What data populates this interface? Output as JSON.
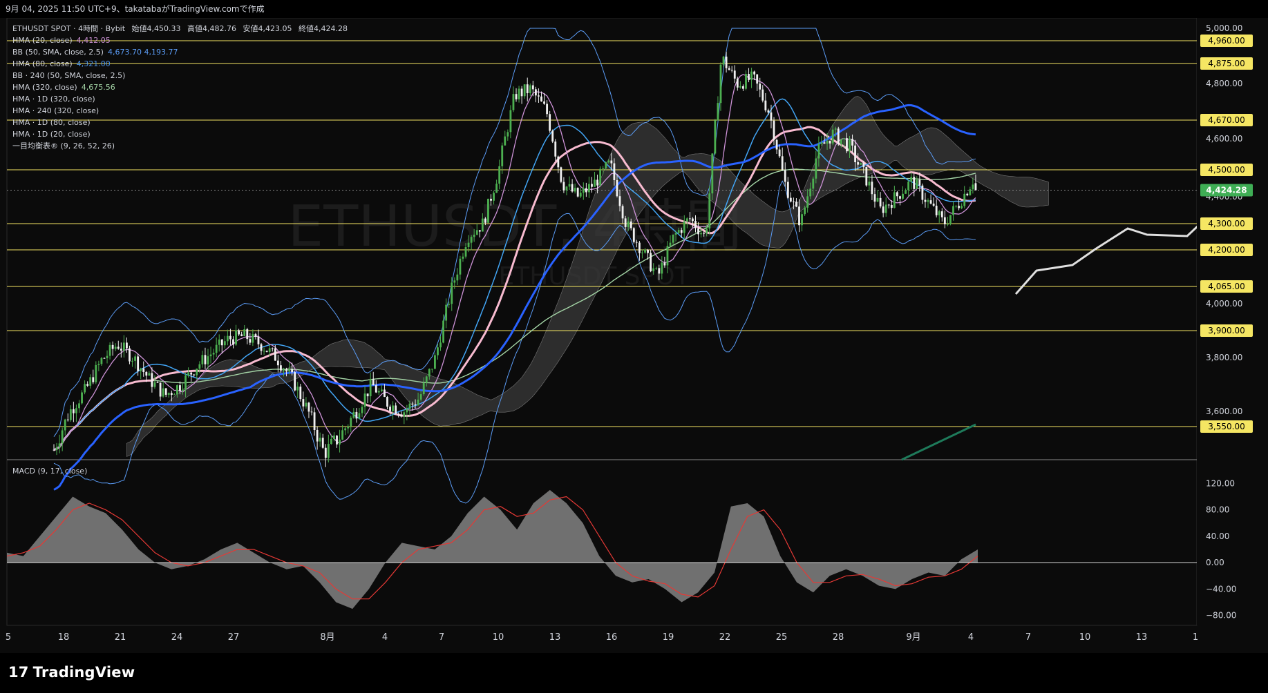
{
  "header": {
    "title": "9月 04, 2025 11:50 UTC+9、takatabaがTradingView.comで作成"
  },
  "legend": {
    "symbol_line": {
      "symbol": "ETHUSDT SPOT · 4時間 · Bybit",
      "open_label": "始値",
      "open": "4,450.33",
      "high_label": "高値",
      "high": "4,482.76",
      "low_label": "安値",
      "low": "4,423.05",
      "close_label": "終値",
      "close": "4,424.28"
    },
    "indicators": [
      {
        "label": "HMA (20, close)",
        "value": "4,412.05",
        "color": "#ce93d8"
      },
      {
        "label": "BB (50, SMA, close, 2.5)",
        "value": "4,673.70  4,193.77",
        "color": "#5b9cf6"
      },
      {
        "label": "HMA (80, close)",
        "value": "4,321.00",
        "color": "#4a90e2"
      },
      {
        "label": "BB · 240 (50, SMA, close, 2.5)",
        "value": "",
        "color": "#d1d4dc"
      },
      {
        "label": "HMA (320, close)",
        "value": "4,675.56",
        "color": "#a5d6a7"
      },
      {
        "label": "HMA · 1D (320, close)",
        "value": "",
        "color": "#d1d4dc"
      },
      {
        "label": "HMA · 240 (320, close)",
        "value": "",
        "color": "#d1d4dc"
      },
      {
        "label": "HMA · 1D (80, close)",
        "value": "",
        "color": "#d1d4dc"
      },
      {
        "label": "HMA · 1D (20, close)",
        "value": "",
        "color": "#d1d4dc"
      },
      {
        "label": "一目均衡表® (9, 26, 52, 26)",
        "value": "",
        "color": "#d1d4dc"
      }
    ]
  },
  "watermark": {
    "main": "ETHUSDT, 4時間",
    "sub": "ETHUSDT SPOT"
  },
  "macd_legend": "MACD (9, 17, close)",
  "brand": {
    "text": "TradingView",
    "mark": "17"
  },
  "colors": {
    "up": "#4caf50",
    "down": "#f0f0f0",
    "hline": "#f5e663",
    "pink": "#f8bbd0",
    "blue": "#2962ff"
  },
  "chart_data": [
    {
      "type": "candlestick",
      "symbol": "ETHUSDT SPOT",
      "x_ticks": [
        "5",
        "18",
        "21",
        "24",
        "27",
        "8月",
        "4",
        "7",
        "10",
        "13",
        "16",
        "19",
        "22",
        "25",
        "28",
        "9月",
        "4",
        "7",
        "10",
        "13",
        "1"
      ],
      "y_ticks": [
        3600,
        3800,
        4000,
        4200,
        4300,
        4400,
        4500,
        4600,
        4800,
        5000
      ],
      "y_tick_labels": [
        "3,600.00",
        "3,800.00",
        "4,000.00",
        "4,200.00",
        "4,300.00",
        "4,400.00",
        "4,500.00",
        "4,600.00",
        "4,800.00",
        "5,000.00"
      ],
      "ylim": [
        3450,
        5000
      ],
      "horizontal_levels": [
        4960,
        4875,
        4670,
        4500,
        4300,
        4200,
        4065,
        3900,
        3550
      ],
      "horizontal_level_labels": [
        "4,960.00",
        "4,875.00",
        "4,670.00",
        "4,500.00",
        "4,300.00",
        "4,200.00",
        "4,065.00",
        "3,900.00",
        "3,550.00"
      ],
      "last_price": 4424.28,
      "last_price_label": "4,424.28",
      "close_path": [
        3480,
        3600,
        3680,
        3790,
        3850,
        3800,
        3720,
        3660,
        3700,
        3770,
        3820,
        3870,
        3880,
        3850,
        3800,
        3720,
        3600,
        3470,
        3520,
        3600,
        3700,
        3630,
        3600,
        3650,
        3800,
        4050,
        4250,
        4300,
        4500,
        4760,
        4780,
        4700,
        4450,
        4400,
        4450,
        4520,
        4300,
        4200,
        4100,
        4250,
        4320,
        4250,
        4900,
        4800,
        4820,
        4700,
        4450,
        4300,
        4550,
        4620,
        4580,
        4480,
        4350,
        4400,
        4460,
        4380,
        4300,
        4380,
        4480
      ],
      "ohlc_last": {
        "open": 4450.33,
        "high": 4482.76,
        "low": 4423.05,
        "close": 4424.28
      }
    },
    {
      "type": "macd",
      "title": "MACD (9, 17, close)",
      "y_ticks": [
        120,
        80,
        40,
        0,
        -40,
        -80
      ],
      "y_tick_labels": [
        "120.00",
        "80.00",
        "40.00",
        "0.00",
        "−40.00",
        "−80.00"
      ],
      "ylim": [
        -95,
        135
      ],
      "macd": [
        15,
        10,
        40,
        70,
        100,
        85,
        75,
        50,
        20,
        0,
        -10,
        -5,
        5,
        20,
        30,
        15,
        0,
        -10,
        -5,
        -30,
        -60,
        -70,
        -40,
        0,
        30,
        25,
        20,
        40,
        75,
        100,
        80,
        50,
        90,
        110,
        90,
        60,
        10,
        -20,
        -30,
        -25,
        -40,
        -60,
        -45,
        -15,
        85,
        90,
        70,
        10,
        -30,
        -45,
        -20,
        -10,
        -20,
        -35,
        -40,
        -25,
        -15,
        -20,
        5,
        20
      ],
      "signal": [
        10,
        15,
        25,
        50,
        80,
        90,
        80,
        65,
        40,
        15,
        0,
        -5,
        0,
        10,
        20,
        20,
        10,
        0,
        -5,
        -15,
        -40,
        -55,
        -55,
        -30,
        0,
        20,
        25,
        30,
        50,
        80,
        85,
        70,
        75,
        95,
        100,
        80,
        40,
        0,
        -20,
        -28,
        -32,
        -48,
        -52,
        -35,
        20,
        70,
        80,
        50,
        0,
        -30,
        -30,
        -20,
        -18,
        -25,
        -35,
        -32,
        -22,
        -20,
        -10,
        10
      ]
    }
  ]
}
